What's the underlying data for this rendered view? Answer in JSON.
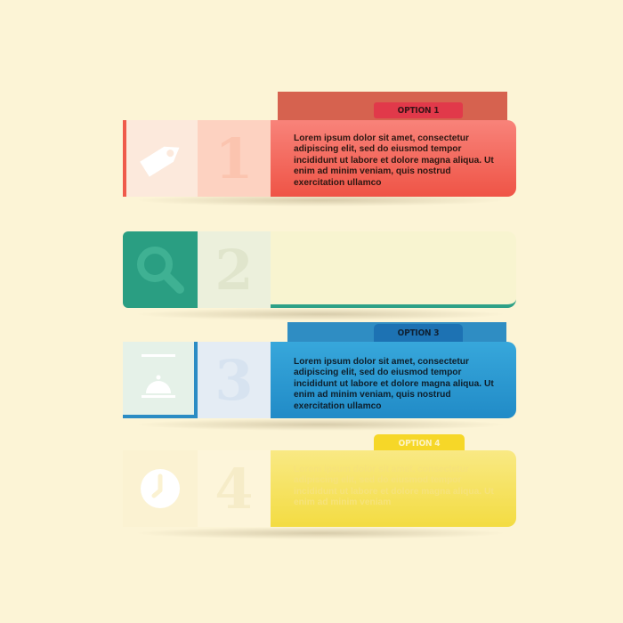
{
  "options": [
    {
      "label": "OPTION 1",
      "number": "1",
      "icon": "tag-icon",
      "text": "Lorem ipsum dolor sit amet, consectetur adipiscing elit, sed do eiusmod tempor incididunt ut labore et dolore magna aliqua. Ut enim ad minim veniam, quis nostrud exercitation ullamco",
      "color": "#ef5446"
    },
    {
      "label": "",
      "number": "2",
      "icon": "search-icon",
      "text": "",
      "color": "#2a9e82"
    },
    {
      "label": "OPTION 3",
      "number": "3",
      "icon": "service-bell-icon",
      "text": "Lorem ipsum dolor sit amet, consectetur adipiscing elit, sed do eiusmod tempor incididunt ut labore et dolore magna aliqua. Ut enim ad minim veniam, quis nostrud exercitation ullamco",
      "color": "#2b8cc4"
    },
    {
      "label": "OPTION 4",
      "number": "4",
      "icon": "clock-icon",
      "text": "Lorem ipsum dolor sit amet, consectetur adipiscing elit, sed do eiusmod tempor incididunt ut labore et dolore magna aliqua. Ut enim ad minim veniam",
      "color": "#f3dc42"
    }
  ]
}
